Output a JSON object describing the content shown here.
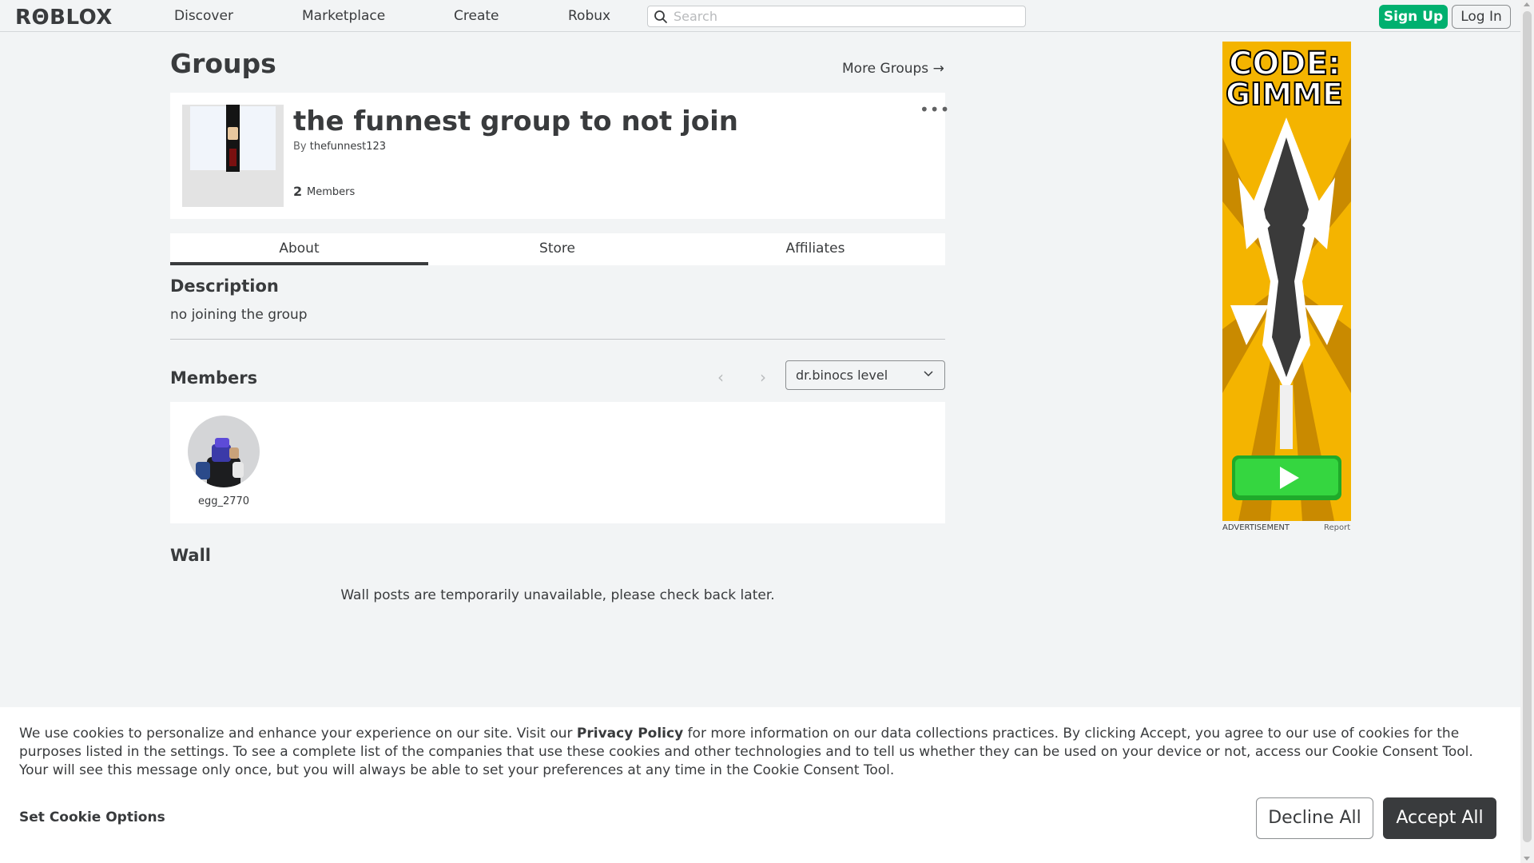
{
  "header": {
    "logo": "RΘBLOX",
    "nav": [
      "Discover",
      "Marketplace",
      "Create",
      "Robux"
    ],
    "search_placeholder": "Search",
    "signup_label": "Sign Up",
    "login_label": "Log In"
  },
  "page": {
    "title": "Groups",
    "more_groups": "More Groups →"
  },
  "group": {
    "name": "the funnest group to not join",
    "by_label": "By",
    "owner": "thefunnest123",
    "member_count": "2",
    "members_label": "Members",
    "more_icon": "•••"
  },
  "tabs": [
    "About",
    "Store",
    "Affiliates"
  ],
  "about": {
    "description_heading": "Description",
    "description_text": "no joining the group",
    "members_heading": "Members",
    "role_selected": "dr.binocs level",
    "members": [
      {
        "name": "egg_2770"
      }
    ],
    "wall_heading": "Wall",
    "wall_message": "Wall posts are temporarily unavailable, please check back later."
  },
  "ad": {
    "headline_line1": "CODE:",
    "headline_line2": "GIMME",
    "label": "ADVERTISEMENT",
    "report": "Report"
  },
  "cookie": {
    "text_before": "We use cookies to personalize and enhance your experience on our site. Visit our ",
    "privacy_link": "Privacy Policy",
    "text_after": " for more information on our data collections practices. By clicking Accept, you agree to our use of cookies for the purposes listed in the settings. To see a complete list of the companies that use these cookies and other technologies and to tell us whether they can be used on your device or not, access our Cookie Consent Tool. Your will see this message only once, but you will always be able to set your preferences at any time in the Cookie Consent Tool.",
    "set_options": "Set Cookie Options",
    "decline": "Decline All",
    "accept": "Accept All"
  },
  "colors": {
    "signup_green": "#00b06f",
    "accept_dark": "#393b3d",
    "page_bg": "#f2f4f5"
  }
}
